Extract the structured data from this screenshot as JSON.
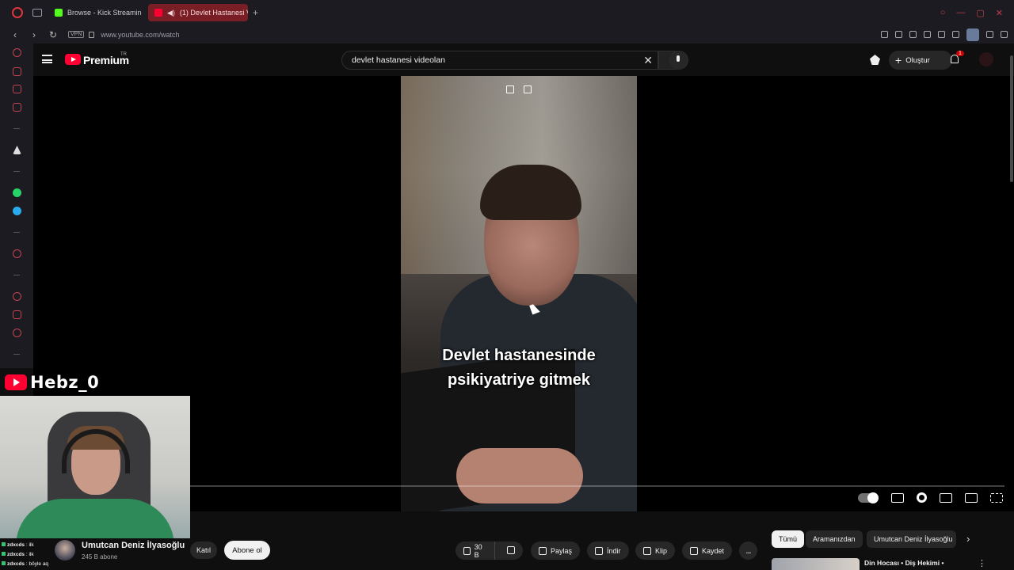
{
  "browser": {
    "tabs": [
      {
        "label": "Browse - Kick Streaming",
        "favicon": "kick-icon",
        "active": false
      },
      {
        "label": "(1) Devlet Hastanesi V",
        "favicon": "youtube-icon",
        "active": true
      }
    ],
    "url": "www.youtube.com/watch",
    "vpn_label": "VPN"
  },
  "youtube": {
    "brand": "Premium",
    "region": "TR",
    "search": {
      "value": "devlet hastanesi videolan"
    },
    "create_label": "Oluştur",
    "notification_count": "1"
  },
  "video": {
    "caption_line1": "Devlet hastanesinde",
    "caption_line2": "psikiyatriye gitmek"
  },
  "overlay": {
    "streamer_handle": "Hebz_0",
    "chat": [
      {
        "user": "zdxcds",
        "message": "ilk"
      },
      {
        "user": "zdxcds",
        "message": "ilk"
      },
      {
        "user": "zdxcds",
        "message": "böyle aq"
      }
    ]
  },
  "channel": {
    "name": "Umutcan Deniz İlyasoğlu",
    "subscribers": "245 B abone",
    "join_label": "Katıl",
    "subscribe_label": "Abone ol"
  },
  "actions": {
    "likes": "30 B",
    "share": "Paylaş",
    "download": "İndir",
    "clip": "Klip",
    "save": "Kaydet",
    "more": "..."
  },
  "recommendations": {
    "chips": [
      "Tümü",
      "Aramanızdan",
      "Umutcan Deniz İlyasoğlu"
    ],
    "first_title": "Din Hocası • Diş Hekimi •"
  },
  "colors": {
    "brand_red": "#ff0033",
    "background": "#0f0f0f",
    "active_tab": "#7a1e26"
  }
}
